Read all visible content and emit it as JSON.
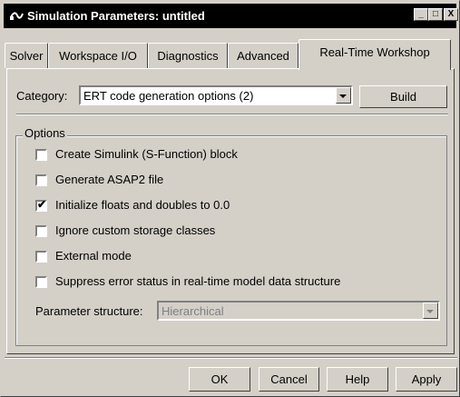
{
  "window": {
    "title": "Simulation Parameters: untitled",
    "controls": {
      "minimize": "_",
      "maximize": "□",
      "close": "X"
    }
  },
  "tabs": [
    {
      "label": "Solver",
      "active": false
    },
    {
      "label": "Workspace I/O",
      "active": false
    },
    {
      "label": "Diagnostics",
      "active": false
    },
    {
      "label": "Advanced",
      "active": false
    },
    {
      "label": "Real-Time Workshop",
      "active": true
    }
  ],
  "category": {
    "label": "Category:",
    "value": "ERT code generation options (2)",
    "build_label": "Build"
  },
  "options": {
    "group_label": "Options",
    "items": [
      {
        "label": "Create Simulink (S-Function) block",
        "checked": false
      },
      {
        "label": "Generate ASAP2 file",
        "checked": false
      },
      {
        "label": "Initialize floats and doubles to 0.0",
        "checked": true
      },
      {
        "label": "Ignore custom storage classes",
        "checked": false
      },
      {
        "label": "External mode",
        "checked": false
      },
      {
        "label": "Suppress error status in real-time model data structure",
        "checked": false
      }
    ],
    "parameter_structure": {
      "label": "Parameter structure:",
      "value": "Hierarchical"
    }
  },
  "footer": {
    "ok": "OK",
    "cancel": "Cancel",
    "help": "Help",
    "apply": "Apply"
  },
  "check_glyph": "✔"
}
